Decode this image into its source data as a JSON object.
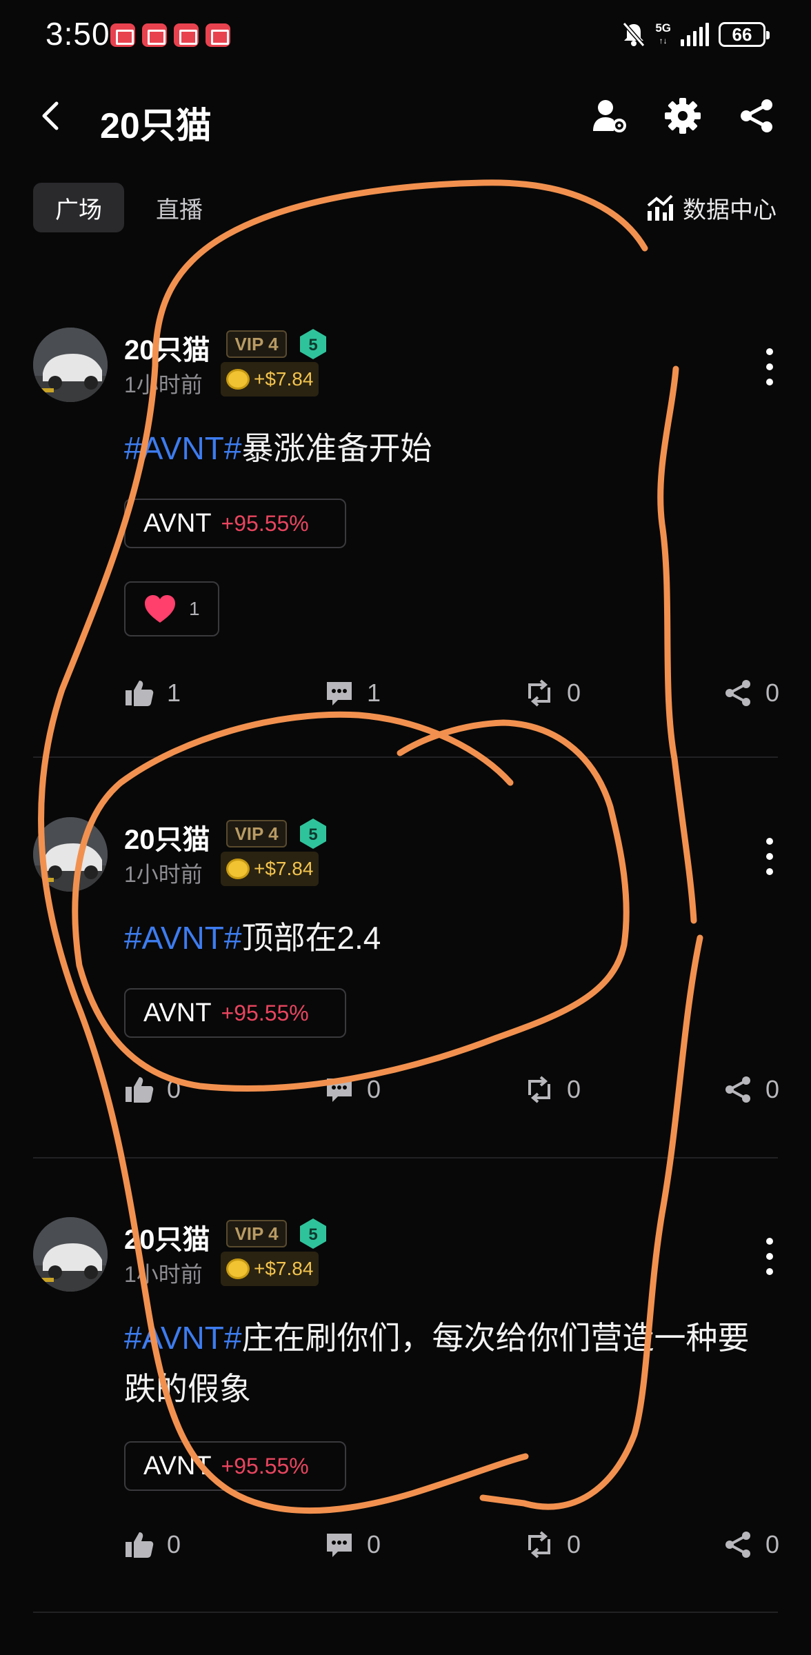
{
  "status_bar": {
    "time": "3:50",
    "network": "5G",
    "battery": "66",
    "icons": [
      "notification-app-icon",
      "notification-app-icon",
      "notification-app-icon",
      "notification-app-icon",
      "mute-bell-icon",
      "signal-icon",
      "battery-icon"
    ]
  },
  "header": {
    "title": "20只猫",
    "icons": [
      "back-icon",
      "user-settings-icon",
      "gear-icon",
      "share-icon"
    ]
  },
  "tabs": {
    "items": [
      {
        "label": "广场",
        "active": true
      },
      {
        "label": "直播",
        "active": false
      }
    ],
    "data_center": "数据中心"
  },
  "posts": [
    {
      "username": "20只猫",
      "vip": "VIP 4",
      "level": "5",
      "time": "1小时前",
      "reward": "+$7.84",
      "hashtag": "#AVNT#",
      "text": "暴涨准备开始",
      "ticker": "AVNT",
      "change": "+95.55%",
      "reaction_count": "1",
      "likes": "1",
      "comments": "1",
      "reposts": "0",
      "shares": "0"
    },
    {
      "username": "20只猫",
      "vip": "VIP 4",
      "level": "5",
      "time": "1小时前",
      "reward": "+$7.84",
      "hashtag": "#AVNT#",
      "text": "顶部在2.4",
      "ticker": "AVNT",
      "change": "+95.55%",
      "likes": "0",
      "comments": "0",
      "reposts": "0",
      "shares": "0"
    },
    {
      "username": "20只猫",
      "vip": "VIP 4",
      "level": "5",
      "time": "1小时前",
      "reward": "+$7.84",
      "hashtag": "#AVNT#",
      "text": "庄在刷你们，每次给你们营造一种要跌的假象",
      "ticker": "AVNT",
      "change": "+95.55%",
      "likes": "0",
      "comments": "0",
      "reposts": "0",
      "shares": "0"
    }
  ],
  "colors": {
    "background": "#080808",
    "hashtag": "#3d7cf0",
    "gain": "#e9455f",
    "vip_gold": "#b99b63",
    "level_green": "#2fc39b",
    "annotation_orange": "#f2914f"
  }
}
